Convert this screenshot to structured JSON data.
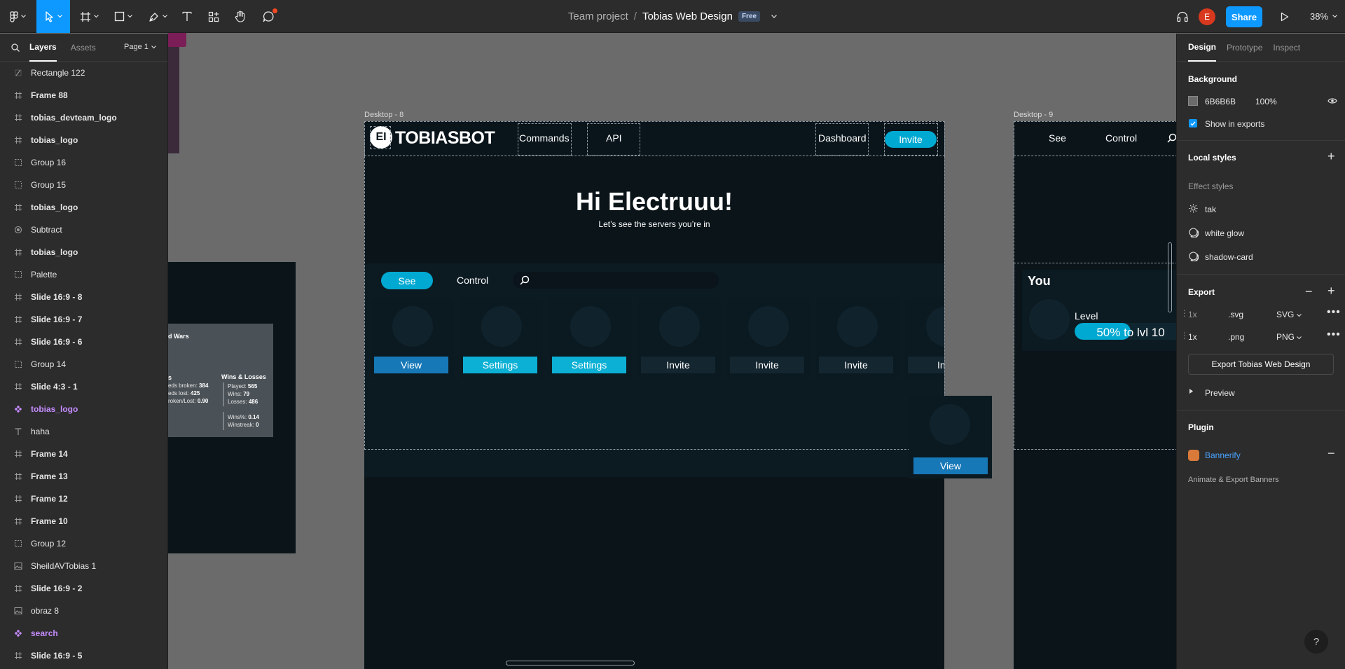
{
  "toolbar": {
    "title_team": "Team project",
    "title_sep": "/",
    "title_file": "Tobias Web Design",
    "plan_badge": "Free",
    "avatar_initial": "E",
    "share_label": "Share",
    "zoom_level": "38%",
    "tools": [
      "figma-menu-icon",
      "move-tool-icon",
      "frame-tool-icon",
      "shape-tool-icon",
      "pen-tool-icon",
      "text-tool-icon",
      "resources-icon",
      "hand-tool-icon",
      "comment-tool-icon"
    ]
  },
  "layers_panel": {
    "tab_layers": "Layers",
    "tab_assets": "Assets",
    "page_label": "Page 1",
    "layers": [
      {
        "name": "Rectangle 122",
        "icon": "rect"
      },
      {
        "name": "Frame 88",
        "icon": "frame"
      },
      {
        "name": "tobias_devteam_logo",
        "icon": "frame"
      },
      {
        "name": "tobias_logo",
        "icon": "frame"
      },
      {
        "name": "Group 16",
        "icon": "group"
      },
      {
        "name": "Group 15",
        "icon": "group"
      },
      {
        "name": "tobias_logo",
        "icon": "frame"
      },
      {
        "name": "Subtract",
        "icon": "boolean"
      },
      {
        "name": "tobias_logo",
        "icon": "frame"
      },
      {
        "name": "Palette",
        "icon": "group"
      },
      {
        "name": "Slide 16:9 - 8",
        "icon": "frame"
      },
      {
        "name": "Slide 16:9 - 7",
        "icon": "frame"
      },
      {
        "name": "Slide 16:9 - 6",
        "icon": "frame"
      },
      {
        "name": "Group 14",
        "icon": "group"
      },
      {
        "name": "Slide 4:3 - 1",
        "icon": "frame"
      },
      {
        "name": "tobias_logo",
        "icon": "component"
      },
      {
        "name": "haha",
        "icon": "text"
      },
      {
        "name": "Frame 14",
        "icon": "frame"
      },
      {
        "name": "Frame 13",
        "icon": "frame"
      },
      {
        "name": "Frame 12",
        "icon": "frame"
      },
      {
        "name": "Frame 10",
        "icon": "frame"
      },
      {
        "name": "Group 12",
        "icon": "group"
      },
      {
        "name": "SheildAVTobias 1",
        "icon": "image"
      },
      {
        "name": "Slide 16:9 - 2",
        "icon": "frame"
      },
      {
        "name": "obraz 8",
        "icon": "image"
      },
      {
        "name": "search",
        "icon": "component"
      },
      {
        "name": "Slide 16:9 - 5",
        "icon": "frame"
      }
    ]
  },
  "canvas": {
    "desktop8_label": "Desktop - 8",
    "desktop9_label": "Desktop - 9",
    "logo_mark": "EI",
    "logo_text": "TOBIASBOT",
    "nav_commands": "Commands",
    "nav_api": "API",
    "nav_dashboard": "Dashboard",
    "nav_invite": "Invite",
    "hero_title": "Hi Electruuu!",
    "hero_subtitle": "Let’s see the servers you’re in",
    "tab_see": "See",
    "tab_control": "Control",
    "server_cards": [
      {
        "button": "View",
        "style": "blue"
      },
      {
        "button": "Settings",
        "style": "cyan"
      },
      {
        "button": "Settings",
        "style": "cyan"
      },
      {
        "button": "Invite",
        "style": "dark"
      },
      {
        "button": "Invite",
        "style": "dark"
      },
      {
        "button": "Invite",
        "style": "dark"
      },
      {
        "button": "Invite",
        "style": "dark"
      }
    ],
    "floating_card_button": "View",
    "d9_tab_see": "See",
    "d9_tab_control": "Control",
    "you_label": "You",
    "level_label": "Level",
    "level_progress_text": "50% to lvl 10",
    "level_progress_fraction": 0.5,
    "stats": {
      "title_frag": "d Wars",
      "col1_title_frag": "s",
      "col1_lines": [
        {
          "label": "eds broken:",
          "value": "384"
        },
        {
          "label": "eds lost:",
          "value": "425"
        },
        {
          "label": "roken/Lost:",
          "value": "0.90"
        }
      ],
      "col2_title": "Wins & Losses",
      "col2_lines": [
        {
          "label": "Played:",
          "value": "565"
        },
        {
          "label": "Wins:",
          "value": "79"
        },
        {
          "label": "Losses:",
          "value": "486"
        }
      ],
      "col2_extra": [
        {
          "label": "Wins%:",
          "value": "0.14"
        },
        {
          "label": "Winstreak:",
          "value": "0"
        }
      ]
    }
  },
  "design_panel": {
    "tab_design": "Design",
    "tab_prototype": "Prototype",
    "tab_inspect": "Inspect",
    "background_heading": "Background",
    "bg_hex": "6B6B6B",
    "bg_opacity": "100%",
    "show_in_exports": "Show in exports",
    "local_styles_heading": "Local styles",
    "effect_styles_label": "Effect styles",
    "effect_styles": [
      "tak",
      "white glow",
      "shadow-card"
    ],
    "export_heading": "Export",
    "export_rows": [
      {
        "scale": "1x",
        "suffix": ".svg",
        "format": "SVG",
        "muted": true
      },
      {
        "scale": "1x",
        "suffix": ".png",
        "format": "PNG",
        "muted": false
      }
    ],
    "export_button": "Export Tobias Web Design",
    "preview_label": "Preview",
    "plugin_heading": "Plugin",
    "plugin_name": "Bannerify",
    "plugin_desc": "Animate & Export Banners",
    "help_label": "?"
  },
  "colors": {
    "canvas": "#6b6b6b",
    "accent_blue": "#0d99ff",
    "cyan": "#00a9d1",
    "frame_bg": "#0a1419"
  }
}
